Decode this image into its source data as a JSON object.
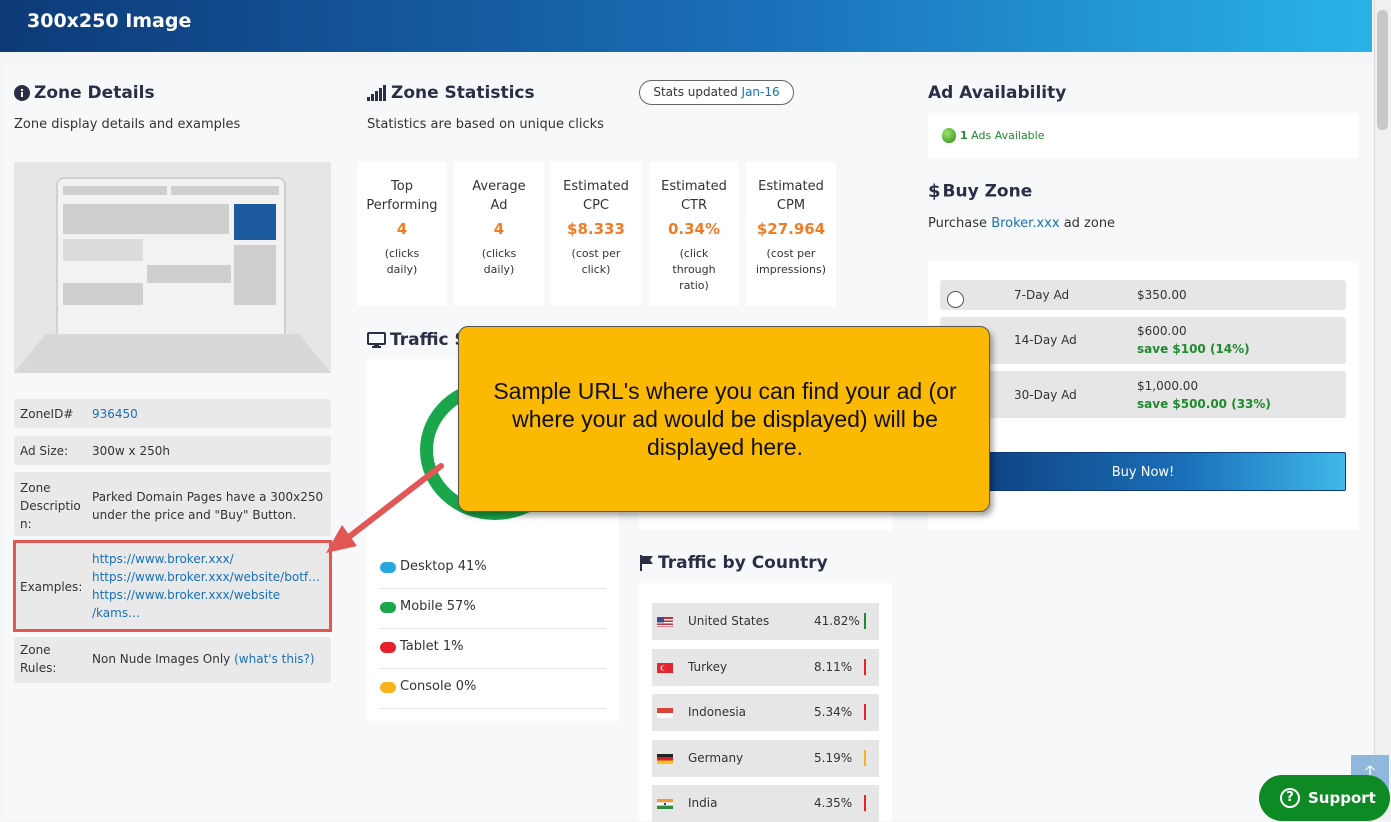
{
  "header": {
    "title": "300x250 Image"
  },
  "zone_details": {
    "title": "Zone Details",
    "subtitle": "Zone display details and examples",
    "rows": {
      "zone_id_label": "ZoneID#",
      "zone_id": "936450",
      "ad_size_label": "Ad Size:",
      "ad_size": "300w x 250h",
      "desc_label_1": "Zone",
      "desc_label_2": "Descriptio",
      "desc_label_3": "n:",
      "desc_1": "Parked Domain Pages have a 300x250",
      "desc_2": "under the price and \"Buy\" Button.",
      "examples_label": "Examples:",
      "example_1": "https://www.broker.xxx/",
      "example_2": "https://www.broker.xxx/website/botf…",
      "example_3": "https://www.broker.xxx/website",
      "example_4": "/kams…",
      "rules_label_1": "Zone",
      "rules_label_2": "Rules:",
      "rules": "Non Nude Images Only",
      "rules_link": "(what's this?)"
    }
  },
  "zone_stats": {
    "title": "Zone Statistics",
    "subtitle": "Statistics are based on unique clicks",
    "badge_label": "Stats updated",
    "badge_date": "Jan-16",
    "cards": [
      {
        "title_1": "Top",
        "title_2": "Performing",
        "value": "4",
        "desc_1": "(clicks",
        "desc_2": "daily)",
        "desc_3": ""
      },
      {
        "title_1": "Average",
        "title_2": "Ad",
        "value": "4",
        "desc_1": "(clicks",
        "desc_2": "daily)",
        "desc_3": ""
      },
      {
        "title_1": "Estimated",
        "title_2": "CPC",
        "value": "$8.333",
        "desc_1": "(cost per",
        "desc_2": "click)",
        "desc_3": ""
      },
      {
        "title_1": "Estimated",
        "title_2": "CTR",
        "value": "0.34%",
        "desc_1": "(click",
        "desc_2": "through",
        "desc_3": "ratio)"
      },
      {
        "title_1": "Estimated",
        "title_2": "CPM",
        "value": "$27.964",
        "desc_1": "(cost per",
        "desc_2": "impressions)",
        "desc_3": ""
      }
    ]
  },
  "traffic_source": {
    "title": "Traffic S",
    "legend": [
      {
        "label": "Desktop 41%",
        "color": "#29a8e0"
      },
      {
        "label": "Mobile 57%",
        "color": "#1aa64a"
      },
      {
        "label": "Tablet 1%",
        "color": "#e8202a"
      },
      {
        "label": "Console 0%",
        "color": "#f7b31b"
      }
    ]
  },
  "traffic_country": {
    "title": "Traffic by Country",
    "rows": [
      {
        "name": "United States",
        "pct": "41.82%",
        "bar": "#1f8a2e"
      },
      {
        "name": "Turkey",
        "pct": "8.11%",
        "bar": "#e8202a"
      },
      {
        "name": "Indonesia",
        "pct": "5.34%",
        "bar": "#e8202a"
      },
      {
        "name": "Germany",
        "pct": "5.19%",
        "bar": "#f7b31b"
      },
      {
        "name": "India",
        "pct": "4.35%",
        "bar": "#e8202a"
      }
    ]
  },
  "ad_availability": {
    "title": "Ad Availability",
    "count": "1",
    "text": "Ads Available"
  },
  "buy_zone": {
    "title": "Buy Zone",
    "subtitle_pre": "Purchase",
    "subtitle_link": "Broker.xxx",
    "subtitle_post": "ad zone",
    "options": [
      {
        "name": "7-Day Ad",
        "price": "$350.00",
        "save": ""
      },
      {
        "name": "14-Day Ad",
        "price": "$600.00",
        "save": "save $100 (14%)"
      },
      {
        "name": "30-Day Ad",
        "price": "$1,000.00",
        "save": "save $500.00 (33%)"
      }
    ],
    "button": "Buy Now!"
  },
  "callout": {
    "line_1": "Sample URL's where you can find your ad (or",
    "line_2": "where your ad would be displayed) will be",
    "line_3": "displayed here."
  },
  "support": {
    "label": "Support",
    "icon": "?",
    "top_arrow": "🡑"
  },
  "colors": {
    "accent": "#1a6fb8",
    "orange": "#ef7d28",
    "green": "#1f8a2e",
    "callout": "#fbb901",
    "highlight": "#e35656"
  }
}
